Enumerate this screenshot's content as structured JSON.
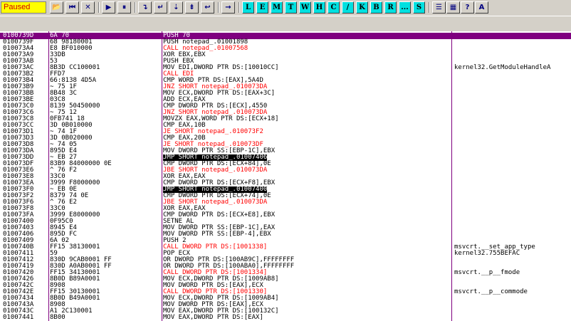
{
  "toolbar": {
    "status": "Paused",
    "icon_buttons": [
      {
        "name": "open-folder-icon",
        "glyph": "📂"
      },
      {
        "name": "rewind-icon",
        "glyph": "⏮"
      },
      {
        "name": "close-icon",
        "glyph": "✕"
      },
      {
        "name": "run-icon",
        "glyph": "▶"
      },
      {
        "name": "pause-icon",
        "glyph": "⏸"
      },
      {
        "name": "step-into-icon",
        "glyph": "↴"
      },
      {
        "name": "step-over-icon",
        "glyph": "↵"
      },
      {
        "name": "trace-into-icon",
        "glyph": "⇣"
      },
      {
        "name": "trace-over-icon",
        "glyph": "⇟"
      },
      {
        "name": "execute-till-return-icon",
        "glyph": "↩"
      },
      {
        "name": "go-to-icon",
        "glyph": "→"
      }
    ],
    "letter_buttons": [
      "L",
      "E",
      "M",
      "T",
      "W",
      "H",
      "C",
      "/",
      "K",
      "B",
      "R",
      "...",
      "S"
    ],
    "right_buttons": [
      {
        "name": "list-icon",
        "glyph": "☰"
      },
      {
        "name": "grid-icon",
        "glyph": "▦"
      },
      {
        "name": "help-icon",
        "glyph": "?"
      },
      {
        "name": "font-icon",
        "glyph": "A"
      }
    ]
  },
  "rows": [
    {
      "addr": "0100739D",
      "hex": "6A 70",
      "dis": "PUSH 70",
      "cmt": "",
      "t": "sel"
    },
    {
      "addr": "0100739F",
      "hex": "68 98180001",
      "dis": "PUSH notepad_.01001898",
      "cmt": "",
      "t": "normal"
    },
    {
      "addr": "010073A4",
      "hex": "E8 BF010000",
      "dis": "CALL notepad_.01007568",
      "cmt": "",
      "t": "call"
    },
    {
      "addr": "010073A9",
      "hex": "33DB",
      "dis": "XOR EBX,EBX",
      "cmt": "",
      "t": "normal"
    },
    {
      "addr": "010073AB",
      "hex": "53",
      "dis": "PUSH EBX",
      "cmt": "",
      "t": "normal"
    },
    {
      "addr": "010073AC",
      "hex": "8B3D CC100001",
      "dis": "MOV EDI,DWORD PTR DS:[10010CC]",
      "cmt": "kernel32.GetModuleHandleA",
      "t": "normal"
    },
    {
      "addr": "010073B2",
      "hex": "FFD7",
      "dis": "CALL EDI",
      "cmt": "",
      "t": "call"
    },
    {
      "addr": "010073B4",
      "hex": "66:8138 4D5A",
      "dis": "CMP WORD PTR DS:[EAX],5A4D",
      "cmt": "",
      "t": "normal"
    },
    {
      "addr": "010073B9",
      "hex": "~ 75 1F",
      "dis": "JNZ SHORT notepad_.010073DA",
      "cmt": "",
      "t": "jcc"
    },
    {
      "addr": "010073BB",
      "hex": "8B48 3C",
      "dis": "MOV ECX,DWORD PTR DS:[EAX+3C]",
      "cmt": "",
      "t": "normal"
    },
    {
      "addr": "010073BE",
      "hex": "03C8",
      "dis": "ADD ECX,EAX",
      "cmt": "",
      "t": "normal"
    },
    {
      "addr": "010073C0",
      "hex": "8139 50450000",
      "dis": "CMP DWORD PTR DS:[ECX],4550",
      "cmt": "",
      "t": "normal"
    },
    {
      "addr": "010073C6",
      "hex": "~ 75 12",
      "dis": "JNZ SHORT notepad_.010073DA",
      "cmt": "",
      "t": "jcc"
    },
    {
      "addr": "010073C8",
      "hex": "0FB741 18",
      "dis": "MOVZX EAX,WORD PTR DS:[ECX+18]",
      "cmt": "",
      "t": "normal"
    },
    {
      "addr": "010073CC",
      "hex": "3D 0B010000",
      "dis": "CMP EAX,10B",
      "cmt": "",
      "t": "normal"
    },
    {
      "addr": "010073D1",
      "hex": "~ 74 1F",
      "dis": "JE SHORT notepad_.010073F2",
      "cmt": "",
      "t": "jcc"
    },
    {
      "addr": "010073D3",
      "hex": "3D 0B020000",
      "dis": "CMP EAX,20B",
      "cmt": "",
      "t": "normal"
    },
    {
      "addr": "010073D8",
      "hex": "~ 74 05",
      "dis": "JE SHORT notepad_.010073DF",
      "cmt": "",
      "t": "jcc"
    },
    {
      "addr": "010073DA",
      "hex": "895D E4",
      "dis": "MOV DWORD PTR SS:[EBP-1C],EBX",
      "cmt": "",
      "t": "normal"
    },
    {
      "addr": "010073DD",
      "hex": "~ EB 27",
      "dis": "JMP SHORT notepad_.01007406",
      "cmt": "",
      "t": "jmp"
    },
    {
      "addr": "010073DF",
      "hex": "83B9 84000000 0E",
      "dis": "CMP DWORD PTR DS:[ECX+84],0E",
      "cmt": "",
      "t": "normal"
    },
    {
      "addr": "010073E6",
      "hex": "^ 76 F2",
      "dis": "JBE SHORT notepad_.010073DA",
      "cmt": "",
      "t": "jcc"
    },
    {
      "addr": "010073E8",
      "hex": "33C0",
      "dis": "XOR EAX,EAX",
      "cmt": "",
      "t": "normal"
    },
    {
      "addr": "010073EA",
      "hex": "3999 F8000000",
      "dis": "CMP DWORD PTR DS:[ECX+F8],EBX",
      "cmt": "",
      "t": "normal"
    },
    {
      "addr": "010073F0",
      "hex": "~ EB 0E",
      "dis": "JMP SHORT notepad_.01007400",
      "cmt": "",
      "t": "jmp"
    },
    {
      "addr": "010073F2",
      "hex": "8379 74 0E",
      "dis": "CMP DWORD PTR DS:[ECX+74],0E",
      "cmt": "",
      "t": "normal"
    },
    {
      "addr": "010073F6",
      "hex": "^ 76 E2",
      "dis": "JBE SHORT notepad_.010073DA",
      "cmt": "",
      "t": "jcc"
    },
    {
      "addr": "010073F8",
      "hex": "33C0",
      "dis": "XOR EAX,EAX",
      "cmt": "",
      "t": "normal"
    },
    {
      "addr": "010073FA",
      "hex": "3999 E8000000",
      "dis": "CMP DWORD PTR DS:[ECX+E8],EBX",
      "cmt": "",
      "t": "normal"
    },
    {
      "addr": "01007400",
      "hex": "0F95C0",
      "dis": "SETNE AL",
      "cmt": "",
      "t": "normal"
    },
    {
      "addr": "01007403",
      "hex": "8945 E4",
      "dis": "MOV DWORD PTR SS:[EBP-1C],EAX",
      "cmt": "",
      "t": "normal"
    },
    {
      "addr": "01007406",
      "hex": "895D FC",
      "dis": "MOV DWORD PTR SS:[EBP-4],EBX",
      "cmt": "",
      "t": "normal"
    },
    {
      "addr": "01007409",
      "hex": "6A 02",
      "dis": "PUSH 2",
      "cmt": "",
      "t": "normal"
    },
    {
      "addr": "0100740B",
      "hex": "FF15 38130001",
      "dis": "CALL DWORD PTR DS:[1001338]",
      "cmt": "msvcrt.__set_app_type",
      "t": "call"
    },
    {
      "addr": "01007411",
      "hex": "59",
      "dis": "POP ECX",
      "cmt": "kernel32.755BEFAC",
      "t": "normal"
    },
    {
      "addr": "01007412",
      "hex": "830D 9CAB0001 FF",
      "dis": "OR DWORD PTR DS:[100AB9C],FFFFFFFF",
      "cmt": "",
      "t": "normal"
    },
    {
      "addr": "01007419",
      "hex": "830D A0AB0001 FF",
      "dis": "OR DWORD PTR DS:[100ABA0],FFFFFFFF",
      "cmt": "",
      "t": "normal"
    },
    {
      "addr": "01007420",
      "hex": "FF15 34130001",
      "dis": "CALL DWORD PTR DS:[1001334]",
      "cmt": "msvcrt.__p__fmode",
      "t": "call"
    },
    {
      "addr": "01007426",
      "hex": "8B0D B89A0001",
      "dis": "MOV ECX,DWORD PTR DS:[1009AB8]",
      "cmt": "",
      "t": "normal"
    },
    {
      "addr": "0100742C",
      "hex": "8908",
      "dis": "MOV DWORD PTR DS:[EAX],ECX",
      "cmt": "",
      "t": "normal"
    },
    {
      "addr": "0100742E",
      "hex": "FF15 30130001",
      "dis": "CALL DWORD PTR DS:[1001330]",
      "cmt": "msvcrt.__p__commode",
      "t": "call"
    },
    {
      "addr": "01007434",
      "hex": "8B0D B49A0001",
      "dis": "MOV ECX,DWORD PTR DS:[1009AB4]",
      "cmt": "",
      "t": "normal"
    },
    {
      "addr": "0100743A",
      "hex": "8908",
      "dis": "MOV DWORD PTR DS:[EAX],ECX",
      "cmt": "",
      "t": "normal"
    },
    {
      "addr": "0100743C",
      "hex": "A1 2C130001",
      "dis": "MOV EAX,DWORD PTR DS:[100132C]",
      "cmt": "",
      "t": "normal"
    },
    {
      "addr": "01007441",
      "hex": "8B00",
      "dis": "MOV EAX,DWORD PTR DS:[EAX]",
      "cmt": "",
      "t": "normal"
    }
  ]
}
